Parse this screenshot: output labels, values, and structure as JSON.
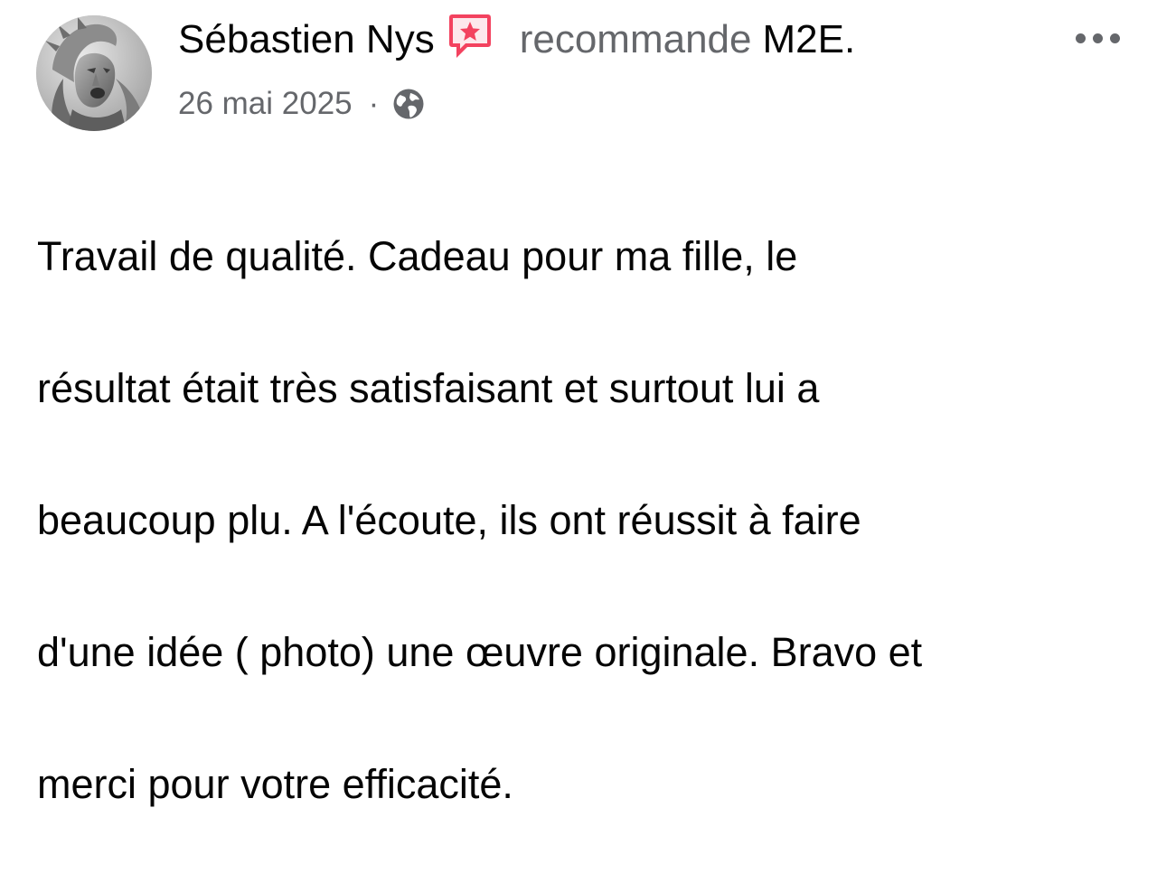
{
  "post": {
    "author": "Sébastien Nys",
    "recommend_text": "recommande",
    "page_name": "M2E.",
    "date": "26 mai 2025",
    "separator": "·",
    "privacy_icon": "globe-icon",
    "recommend_icon": "recommendation-icon",
    "more_icon": "more-options-icon",
    "body_lines": [
      "Travail de qualité.  Cadeau pour ma fille, le",
      "résultat était très satisfaisant et surtout lui a",
      "beaucoup plu. A l'écoute, ils ont réussit à faire",
      "d'une idée ( photo) une œuvre originale.  Bravo et",
      "merci pour votre efficacité."
    ]
  },
  "colors": {
    "primary_text": "#050505",
    "secondary_text": "#65676b",
    "recommend_icon": "#f3425f",
    "background": "#ffffff"
  }
}
